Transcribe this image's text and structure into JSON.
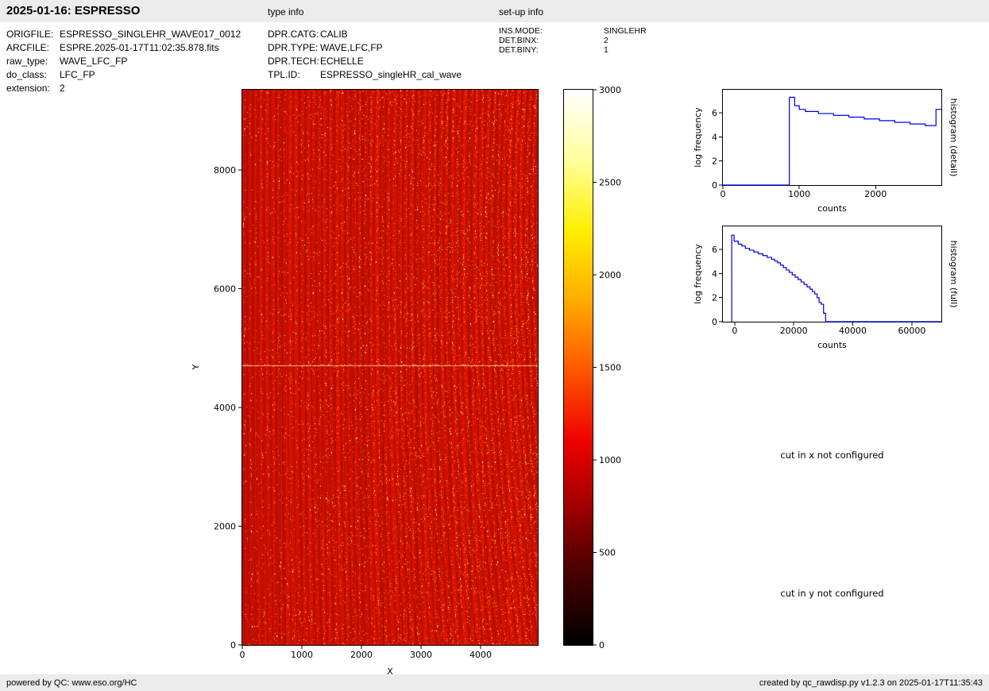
{
  "header": {
    "title": "2025-01-16: ESPRESSO",
    "type_info_label": "type info",
    "setup_info_label": "set-up info"
  },
  "file_info": [
    {
      "label": "ORIGFILE:",
      "value": "ESPRESSO_SINGLEHR_WAVE017_0012"
    },
    {
      "label": "ARCFILE:",
      "value": "ESPRE.2025-01-17T11:02:35.878.fits"
    },
    {
      "label": "raw_type:",
      "value": "WAVE_LFC_FP"
    },
    {
      "label": "do_class:",
      "value": "LFC_FP"
    },
    {
      "label": "extension:",
      "value": "2"
    }
  ],
  "type_info": [
    {
      "label": "DPR.CATG:",
      "value": "CALIB"
    },
    {
      "label": "DPR.TYPE:",
      "value": "WAVE,LFC,FP"
    },
    {
      "label": "DPR.TECH:",
      "value": "ECHELLE"
    },
    {
      "label": "TPL.ID:",
      "value": "ESPRESSO_singleHR_cal_wave"
    }
  ],
  "setup_info": [
    {
      "label": "INS.MODE:",
      "value": "SINGLEHR"
    },
    {
      "label": "DET.BINX:",
      "value": "2"
    },
    {
      "label": "DET.BINY:",
      "value": "1"
    }
  ],
  "messages": {
    "cut_x": "cut in x not configured",
    "cut_y": "cut in y not configured"
  },
  "footer": {
    "left": "powered by QC: www.eso.org/HC",
    "right": "created by qc_rawdisp.py v1.2.3 on 2025-01-17T11:35:43"
  },
  "chart_data": [
    {
      "id": "raw_image",
      "type": "heatmap",
      "xlabel": "X",
      "ylabel": "Y",
      "xlim": [
        0,
        4960
      ],
      "ylim": [
        0,
        9350
      ],
      "x_ticks": [
        0,
        1000,
        2000,
        3000,
        4000
      ],
      "y_ticks": [
        0,
        2000,
        4000,
        6000,
        8000
      ],
      "value_range": [
        0,
        3000
      ],
      "colormap": "hot",
      "colorbar_ticks": [
        0,
        500,
        1000,
        1500,
        2000,
        2500,
        3000
      ],
      "content_note": "Raw ESPRESSO echelle frame: red field of curved vertical spectral orders dotted with yellow/white LFC comb lines, density increasing to the right, bright horizontal detector line at y ~ 4700"
    },
    {
      "id": "histogram_detail",
      "type": "line",
      "right_label": "histogram (detail)",
      "xlabel": "counts",
      "ylabel": "log frequency",
      "xlim": [
        0,
        2860
      ],
      "ylim": [
        0,
        7.93
      ],
      "x_ticks": [
        0,
        1000,
        2000
      ],
      "y_ticks": [
        0,
        2,
        4,
        6
      ],
      "line_color": "#0000dd",
      "step": true,
      "points": [
        [
          0,
          0
        ],
        [
          870,
          0
        ],
        [
          940,
          7.3
        ],
        [
          1000,
          6.6
        ],
        [
          1080,
          6.3
        ],
        [
          1250,
          6.12
        ],
        [
          1450,
          5.95
        ],
        [
          1650,
          5.8
        ],
        [
          1850,
          5.65
        ],
        [
          2050,
          5.5
        ],
        [
          2250,
          5.36
        ],
        [
          2450,
          5.22
        ],
        [
          2650,
          5.08
        ],
        [
          2790,
          4.95
        ],
        [
          2820,
          6.3
        ],
        [
          2860,
          6.3
        ]
      ]
    },
    {
      "id": "histogram_full",
      "type": "line",
      "right_label": "histogram (full)",
      "xlabel": "counts",
      "ylabel": "log frequency",
      "xlim": [
        -4000,
        70000
      ],
      "ylim": [
        0,
        7.93
      ],
      "x_ticks": [
        0,
        20000,
        40000,
        60000
      ],
      "y_ticks": [
        0,
        2,
        4,
        6
      ],
      "line_color": "#0000dd",
      "step": true,
      "points": [
        [
          -1000,
          0
        ],
        [
          -200,
          7.2
        ],
        [
          1200,
          6.7
        ],
        [
          2400,
          6.45
        ],
        [
          3600,
          6.3
        ],
        [
          5000,
          6.1
        ],
        [
          6500,
          5.95
        ],
        [
          8000,
          5.8
        ],
        [
          9500,
          5.65
        ],
        [
          11000,
          5.5
        ],
        [
          12500,
          5.35
        ],
        [
          13500,
          5.2
        ],
        [
          14500,
          5.05
        ],
        [
          15500,
          4.9
        ],
        [
          16500,
          4.7
        ],
        [
          17500,
          4.5
        ],
        [
          18500,
          4.3
        ],
        [
          19500,
          4.1
        ],
        [
          20500,
          3.9
        ],
        [
          21500,
          3.7
        ],
        [
          22500,
          3.5
        ],
        [
          23500,
          3.3
        ],
        [
          24500,
          3.1
        ],
        [
          25500,
          2.9
        ],
        [
          26300,
          2.7
        ],
        [
          27100,
          2.5
        ],
        [
          27900,
          2.3
        ],
        [
          28600,
          2.0
        ],
        [
          29300,
          1.6
        ],
        [
          30100,
          1.45
        ],
        [
          30800,
          0.7
        ],
        [
          31400,
          0
        ],
        [
          70000,
          0
        ]
      ]
    }
  ]
}
